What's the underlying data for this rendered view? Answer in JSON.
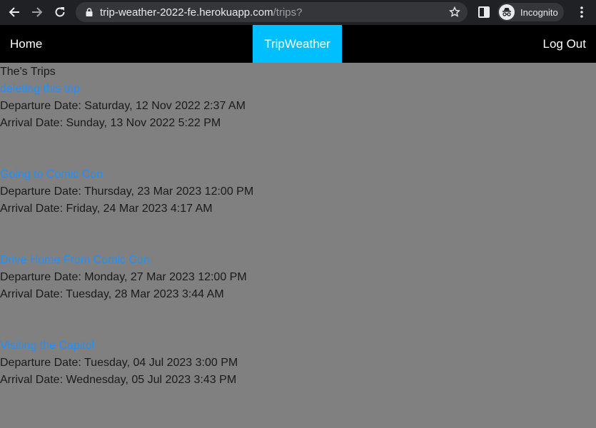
{
  "browser": {
    "url_host": "trip-weather-2022-fe.herokuapp.com",
    "url_path": "/trips?",
    "incognito_label": "Incognito"
  },
  "navbar": {
    "home_label": "Home",
    "brand_label": "TripWeather",
    "logout_label": "Log Out",
    "accent_color": "#00bfff"
  },
  "page": {
    "title": "The's Trips"
  },
  "trips": [
    {
      "name": "deleting this trip",
      "departure": "Departure Date: Saturday, 12 Nov 2022 2:37 AM",
      "arrival": "Arrival Date: Sunday, 13 Nov 2022 5:22 PM"
    },
    {
      "name": "Going to Comic Con",
      "departure": "Departure Date: Thursday, 23 Mar 2023 12:00 PM",
      "arrival": "Arrival Date: Friday, 24 Mar 2023 4:17 AM"
    },
    {
      "name": "Drive Home From Comic Con",
      "departure": "Departure Date: Monday, 27 Mar 2023 12:00 PM",
      "arrival": "Arrival Date: Tuesday, 28 Mar 2023 3:44 AM"
    },
    {
      "name": "Visiting the Capitol",
      "departure": "Departure Date: Tuesday, 04 Jul 2023 3:00 PM",
      "arrival": "Arrival Date: Wednesday, 05 Jul 2023 3:43 PM"
    }
  ]
}
